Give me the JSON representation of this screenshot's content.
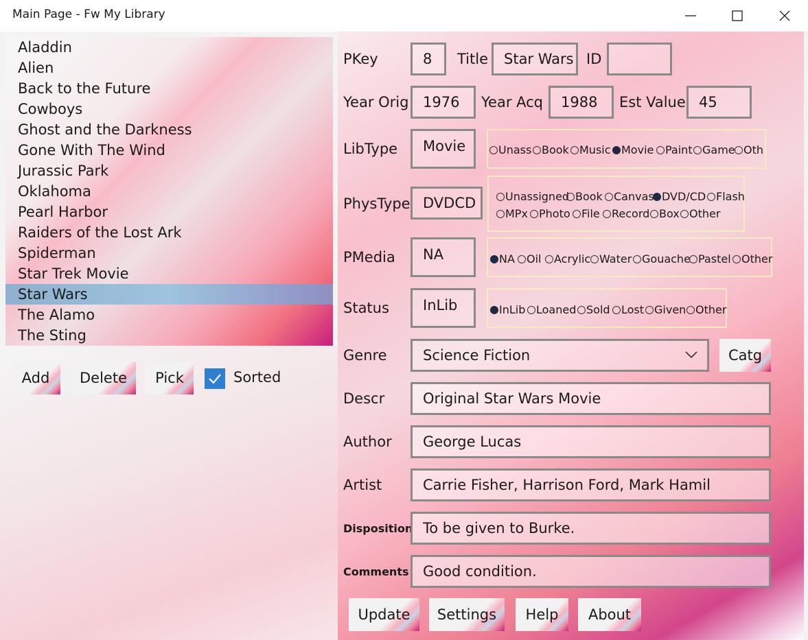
{
  "window": {
    "title": "Main Page - Fw My Library"
  },
  "library": {
    "items": [
      "Aladdin",
      "Alien",
      "Back to the Future",
      "Cowboys",
      "Ghost and the Darkness",
      "Gone With The Wind",
      "Jurassic Park",
      "Oklahoma",
      "Pearl Harbor",
      "Raiders of the Lost Ark",
      "Spiderman",
      "Star Trek Movie",
      "Star Wars",
      "The Alamo",
      "The Sting"
    ],
    "selected": "Star Wars"
  },
  "list_buttons": {
    "add": "Add",
    "delete": "Delete",
    "pick": "Pick"
  },
  "sorted": {
    "label": "Sorted",
    "checked": true
  },
  "form": {
    "pkey_label": "PKey",
    "pkey": "8",
    "title_label": "Title",
    "title": "Star Wars",
    "id_label": "ID",
    "id": "",
    "year_orig_label": "Year Orig",
    "year_orig": "1976",
    "year_acq_label": "Year Acq",
    "year_acq": "1988",
    "est_value_label": "Est Value",
    "est_value": "45",
    "libtype_label": "LibType",
    "libtype": "Movie",
    "libtype_options": [
      "Unass",
      "Book",
      "Music",
      "Movie",
      "Paint",
      "Game",
      "Oth"
    ],
    "libtype_selected": "Movie",
    "phystype_label": "PhysType",
    "phystype": "DVDCD",
    "phystype_options": [
      "Unassigned",
      "Book",
      "Canvas",
      "DVD/CD",
      "Flash",
      "MPx",
      "Photo",
      "File",
      "Record",
      "Box",
      "Other"
    ],
    "phystype_selected": "DVD/CD",
    "pmedia_label": "PMedia",
    "pmedia": "NA",
    "pmedia_options": [
      "NA",
      "Oil",
      "Acrylic",
      "Water",
      "Gouache",
      "Pastel",
      "Other"
    ],
    "pmedia_selected": "NA",
    "status_label": "Status",
    "status": "InLib",
    "status_options": [
      "InLib",
      "Loaned",
      "Sold",
      "Lost",
      "Given",
      "Other"
    ],
    "status_selected": "InLib",
    "genre_label": "Genre",
    "genre": "Science Fiction",
    "catg_button": "Catg",
    "descr_label": "Descr",
    "descr": "Original Star Wars Movie",
    "author_label": "Author",
    "author": "George Lucas",
    "artist_label": "Artist",
    "artist": "Carrie Fisher, Harrison Ford, Mark Hamil",
    "disposition_label": "Disposition",
    "disposition": "To be given to Burke.",
    "comments_label": "Comments",
    "comments": "Good condition."
  },
  "bottom_buttons": {
    "update": "Update",
    "settings": "Settings",
    "help": "Help",
    "about": "About"
  }
}
